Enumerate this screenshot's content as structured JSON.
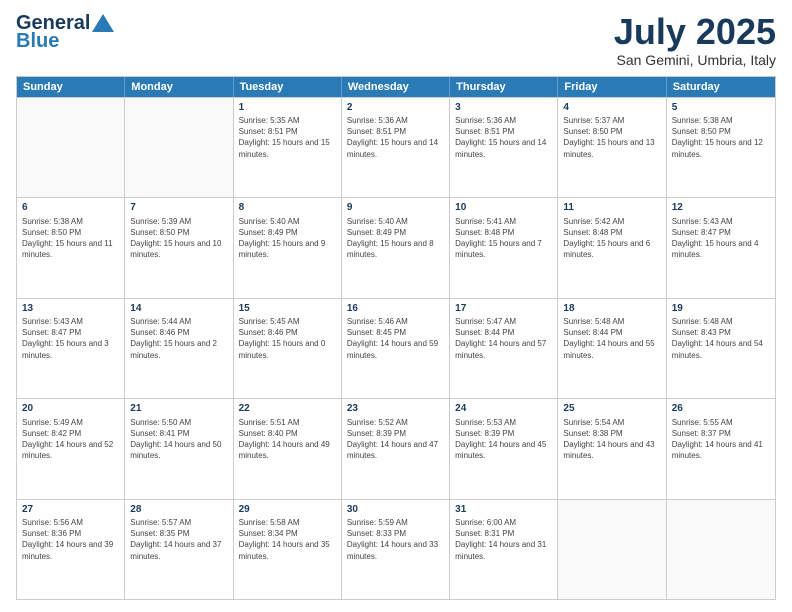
{
  "logo": {
    "line1": "General",
    "line2": "Blue"
  },
  "title": "July 2025",
  "location": "San Gemini, Umbria, Italy",
  "days_header": [
    "Sunday",
    "Monday",
    "Tuesday",
    "Wednesday",
    "Thursday",
    "Friday",
    "Saturday"
  ],
  "weeks": [
    [
      {
        "day": "",
        "sunrise": "",
        "sunset": "",
        "daylight": ""
      },
      {
        "day": "",
        "sunrise": "",
        "sunset": "",
        "daylight": ""
      },
      {
        "day": "1",
        "sunrise": "Sunrise: 5:35 AM",
        "sunset": "Sunset: 8:51 PM",
        "daylight": "Daylight: 15 hours and 15 minutes."
      },
      {
        "day": "2",
        "sunrise": "Sunrise: 5:36 AM",
        "sunset": "Sunset: 8:51 PM",
        "daylight": "Daylight: 15 hours and 14 minutes."
      },
      {
        "day": "3",
        "sunrise": "Sunrise: 5:36 AM",
        "sunset": "Sunset: 8:51 PM",
        "daylight": "Daylight: 15 hours and 14 minutes."
      },
      {
        "day": "4",
        "sunrise": "Sunrise: 5:37 AM",
        "sunset": "Sunset: 8:50 PM",
        "daylight": "Daylight: 15 hours and 13 minutes."
      },
      {
        "day": "5",
        "sunrise": "Sunrise: 5:38 AM",
        "sunset": "Sunset: 8:50 PM",
        "daylight": "Daylight: 15 hours and 12 minutes."
      }
    ],
    [
      {
        "day": "6",
        "sunrise": "Sunrise: 5:38 AM",
        "sunset": "Sunset: 8:50 PM",
        "daylight": "Daylight: 15 hours and 11 minutes."
      },
      {
        "day": "7",
        "sunrise": "Sunrise: 5:39 AM",
        "sunset": "Sunset: 8:50 PM",
        "daylight": "Daylight: 15 hours and 10 minutes."
      },
      {
        "day": "8",
        "sunrise": "Sunrise: 5:40 AM",
        "sunset": "Sunset: 8:49 PM",
        "daylight": "Daylight: 15 hours and 9 minutes."
      },
      {
        "day": "9",
        "sunrise": "Sunrise: 5:40 AM",
        "sunset": "Sunset: 8:49 PM",
        "daylight": "Daylight: 15 hours and 8 minutes."
      },
      {
        "day": "10",
        "sunrise": "Sunrise: 5:41 AM",
        "sunset": "Sunset: 8:48 PM",
        "daylight": "Daylight: 15 hours and 7 minutes."
      },
      {
        "day": "11",
        "sunrise": "Sunrise: 5:42 AM",
        "sunset": "Sunset: 8:48 PM",
        "daylight": "Daylight: 15 hours and 6 minutes."
      },
      {
        "day": "12",
        "sunrise": "Sunrise: 5:43 AM",
        "sunset": "Sunset: 8:47 PM",
        "daylight": "Daylight: 15 hours and 4 minutes."
      }
    ],
    [
      {
        "day": "13",
        "sunrise": "Sunrise: 5:43 AM",
        "sunset": "Sunset: 8:47 PM",
        "daylight": "Daylight: 15 hours and 3 minutes."
      },
      {
        "day": "14",
        "sunrise": "Sunrise: 5:44 AM",
        "sunset": "Sunset: 8:46 PM",
        "daylight": "Daylight: 15 hours and 2 minutes."
      },
      {
        "day": "15",
        "sunrise": "Sunrise: 5:45 AM",
        "sunset": "Sunset: 8:46 PM",
        "daylight": "Daylight: 15 hours and 0 minutes."
      },
      {
        "day": "16",
        "sunrise": "Sunrise: 5:46 AM",
        "sunset": "Sunset: 8:45 PM",
        "daylight": "Daylight: 14 hours and 59 minutes."
      },
      {
        "day": "17",
        "sunrise": "Sunrise: 5:47 AM",
        "sunset": "Sunset: 8:44 PM",
        "daylight": "Daylight: 14 hours and 57 minutes."
      },
      {
        "day": "18",
        "sunrise": "Sunrise: 5:48 AM",
        "sunset": "Sunset: 8:44 PM",
        "daylight": "Daylight: 14 hours and 55 minutes."
      },
      {
        "day": "19",
        "sunrise": "Sunrise: 5:48 AM",
        "sunset": "Sunset: 8:43 PM",
        "daylight": "Daylight: 14 hours and 54 minutes."
      }
    ],
    [
      {
        "day": "20",
        "sunrise": "Sunrise: 5:49 AM",
        "sunset": "Sunset: 8:42 PM",
        "daylight": "Daylight: 14 hours and 52 minutes."
      },
      {
        "day": "21",
        "sunrise": "Sunrise: 5:50 AM",
        "sunset": "Sunset: 8:41 PM",
        "daylight": "Daylight: 14 hours and 50 minutes."
      },
      {
        "day": "22",
        "sunrise": "Sunrise: 5:51 AM",
        "sunset": "Sunset: 8:40 PM",
        "daylight": "Daylight: 14 hours and 49 minutes."
      },
      {
        "day": "23",
        "sunrise": "Sunrise: 5:52 AM",
        "sunset": "Sunset: 8:39 PM",
        "daylight": "Daylight: 14 hours and 47 minutes."
      },
      {
        "day": "24",
        "sunrise": "Sunrise: 5:53 AM",
        "sunset": "Sunset: 8:39 PM",
        "daylight": "Daylight: 14 hours and 45 minutes."
      },
      {
        "day": "25",
        "sunrise": "Sunrise: 5:54 AM",
        "sunset": "Sunset: 8:38 PM",
        "daylight": "Daylight: 14 hours and 43 minutes."
      },
      {
        "day": "26",
        "sunrise": "Sunrise: 5:55 AM",
        "sunset": "Sunset: 8:37 PM",
        "daylight": "Daylight: 14 hours and 41 minutes."
      }
    ],
    [
      {
        "day": "27",
        "sunrise": "Sunrise: 5:56 AM",
        "sunset": "Sunset: 8:36 PM",
        "daylight": "Daylight: 14 hours and 39 minutes."
      },
      {
        "day": "28",
        "sunrise": "Sunrise: 5:57 AM",
        "sunset": "Sunset: 8:35 PM",
        "daylight": "Daylight: 14 hours and 37 minutes."
      },
      {
        "day": "29",
        "sunrise": "Sunrise: 5:58 AM",
        "sunset": "Sunset: 8:34 PM",
        "daylight": "Daylight: 14 hours and 35 minutes."
      },
      {
        "day": "30",
        "sunrise": "Sunrise: 5:59 AM",
        "sunset": "Sunset: 8:33 PM",
        "daylight": "Daylight: 14 hours and 33 minutes."
      },
      {
        "day": "31",
        "sunrise": "Sunrise: 6:00 AM",
        "sunset": "Sunset: 8:31 PM",
        "daylight": "Daylight: 14 hours and 31 minutes."
      },
      {
        "day": "",
        "sunrise": "",
        "sunset": "",
        "daylight": ""
      },
      {
        "day": "",
        "sunrise": "",
        "sunset": "",
        "daylight": ""
      }
    ]
  ]
}
